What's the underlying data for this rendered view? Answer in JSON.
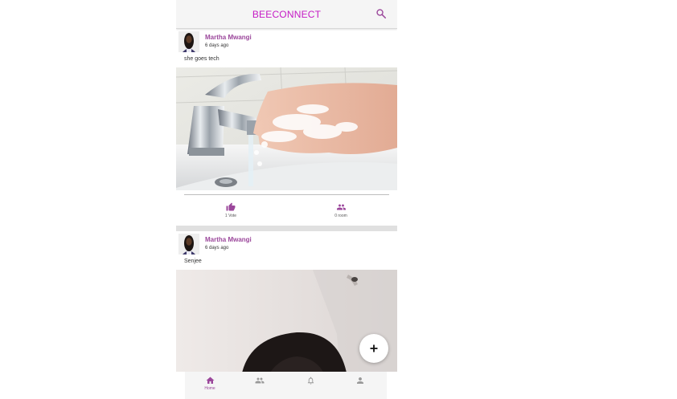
{
  "app": {
    "title": "BEECONNECT"
  },
  "colors": {
    "brand": "#c51bc5",
    "accent": "#9b479b",
    "inactive": "#999999"
  },
  "posts": [
    {
      "author": "Martha Mwangi",
      "time": "6 days ago",
      "caption": "she goes tech",
      "image": "handwashing-photo",
      "actions": {
        "vote_label": "1 Vote",
        "room_label": "0 room"
      }
    },
    {
      "author": "Martha Mwangi",
      "time": "6 days ago",
      "caption": "Senjee",
      "image": "portrait-photo"
    }
  ],
  "nav": {
    "items": [
      {
        "icon": "home-icon",
        "label": "Home",
        "active": true
      },
      {
        "icon": "people-icon",
        "label": "",
        "active": false
      },
      {
        "icon": "bell-icon",
        "label": "",
        "active": false
      },
      {
        "icon": "person-icon",
        "label": "",
        "active": false
      }
    ]
  },
  "fab": {
    "icon": "plus-icon"
  }
}
